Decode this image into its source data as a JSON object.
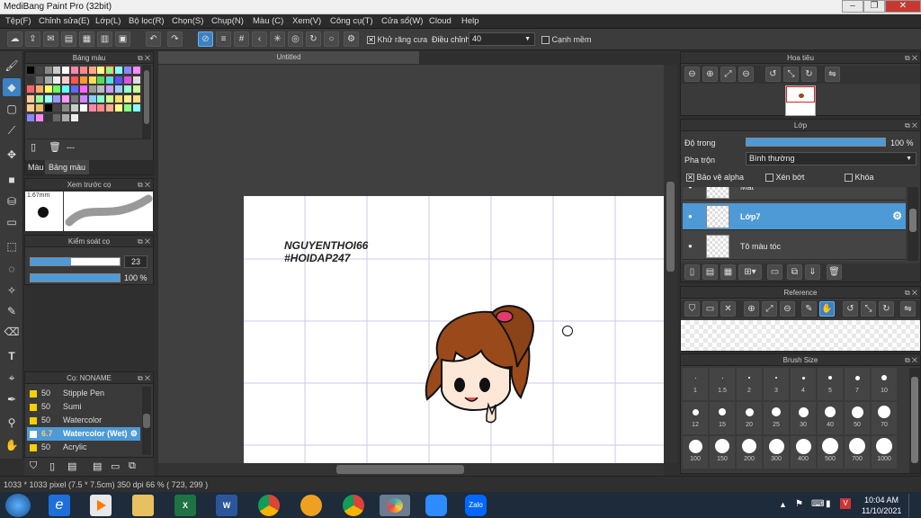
{
  "window": {
    "title": "MediBang Paint Pro (32bit)"
  },
  "menu": [
    "Tệp(F)",
    "Chỉnh sửa(E)",
    "Lớp(L)",
    "Bộ lọc(R)",
    "Chọn(S)",
    "Chụp(N)",
    "Màu (C)",
    "Xem(V)",
    "Công cụ(T)",
    "Cửa sổ(W)",
    "Cloud",
    "Help"
  ],
  "toolbar": {
    "antialias": "Khử răng cưa",
    "correction_label": "Điều chỉnh",
    "correction_value": "40",
    "edge": "Cạnh mềm"
  },
  "palette": {
    "title": "Bảng màu",
    "tab_color": "Màu",
    "tab_palette": "Bảng màu",
    "dash": "---"
  },
  "brush_preview": {
    "title": "Xem trước cọ",
    "size": "1.67mm"
  },
  "brush_control": {
    "title": "Kiểm soát cọ",
    "size": "23",
    "opacity": "100 %",
    "size_fill": 0.45,
    "opacity_fill": 1.0
  },
  "brushes": {
    "title": "Cọ: NONAME",
    "items": [
      {
        "size": "50",
        "name": "Stipple Pen"
      },
      {
        "size": "50",
        "name": "Sumi"
      },
      {
        "size": "50",
        "name": "Watercolor"
      },
      {
        "size": "6.7",
        "name": "Watercolor (Wet)"
      },
      {
        "size": "50",
        "name": "Acrylic"
      }
    ],
    "selected_index": 3
  },
  "canvas": {
    "tab": "Untitled",
    "text_line1": "NGUYENTHOI66",
    "text_line2": "#HOIDAP247"
  },
  "navigator": {
    "title": "Hoa tiêu"
  },
  "layer": {
    "title": "Lớp",
    "opacity_label": "Độ trong",
    "opacity_value": "100 %",
    "opacity_fill": 1.0,
    "blend_label": "Pha trộn",
    "blend_value": "Bình thường",
    "protect_alpha": "Bảo vệ alpha",
    "clipping": "Xén bớt",
    "lock": "Khóa",
    "items": [
      {
        "name": "Mắt"
      },
      {
        "name": "Lớp7"
      },
      {
        "name": "Tô màu tóc"
      }
    ],
    "selected_index": 1
  },
  "reference": {
    "title": "Reference"
  },
  "brush_size": {
    "title": "Brush Size",
    "sizes": [
      "1",
      "1.5",
      "2",
      "3",
      "4",
      "5",
      "7",
      "10",
      "12",
      "15",
      "20",
      "25",
      "30",
      "40",
      "50",
      "70",
      "100",
      "150",
      "200",
      "300",
      "400",
      "500",
      "700",
      "1000"
    ]
  },
  "status": {
    "text": "1033 * 1033 pixel  (7.5 * 7.5cm)  350 dpi  66 %  ( 723, 299 )"
  },
  "taskbar": {
    "time": "10:04 AM",
    "date": "11/10/2021"
  }
}
